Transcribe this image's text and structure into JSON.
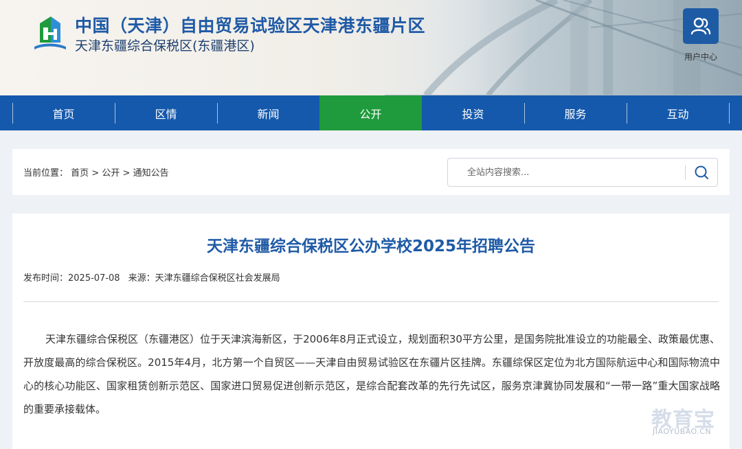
{
  "header": {
    "title": "中国（天津）自由贸易试验区天津港东疆片区",
    "subtitle": "天津东疆综合保税区(东疆港区)",
    "user_center_label": "用户中心",
    "brand_color": "#1f5aa6"
  },
  "nav": {
    "items": [
      {
        "label": "首页"
      },
      {
        "label": "区情"
      },
      {
        "label": "新闻"
      },
      {
        "label": "公开"
      },
      {
        "label": "投资"
      },
      {
        "label": "服务"
      },
      {
        "label": "互动"
      }
    ],
    "active_index": 3,
    "bar_color": "#1559ac",
    "active_color": "#1f9a3c"
  },
  "breadcrumb": {
    "prefix": "当前位置：",
    "items": [
      "首页",
      "公开",
      "通知公告"
    ],
    "separator": ">"
  },
  "search": {
    "placeholder": "全站内容搜索..."
  },
  "article": {
    "title": "天津东疆综合保税区公办学校2025年招聘公告",
    "publish_label": "发布时间：",
    "publish_date": "2025-07-08",
    "source_label": "来源：",
    "source": "天津东疆综合保税区社会发展局",
    "paragraph": "天津东疆综合保税区（东疆港区）位于天津滨海新区，于2006年8月正式设立，规划面积30平方公里，是国务院批准设立的功能最全、政策最优惠、开放度最高的综合保税区。2015年4月，北方第一个自贸区——天津自由贸易试验区在东疆片区挂牌。东疆综保区定位为北方国际航运中心和国际物流中心的核心功能区、国家租赁创新示范区、国家进口贸易促进创新示范区，是综合配套改革的先行先试区，服务京津冀协同发展和“一带一路”重大国家战略的重要承接载体。"
  },
  "watermark": {
    "cn": "教育宝",
    "en": "JIAOYUBAO.CN"
  }
}
